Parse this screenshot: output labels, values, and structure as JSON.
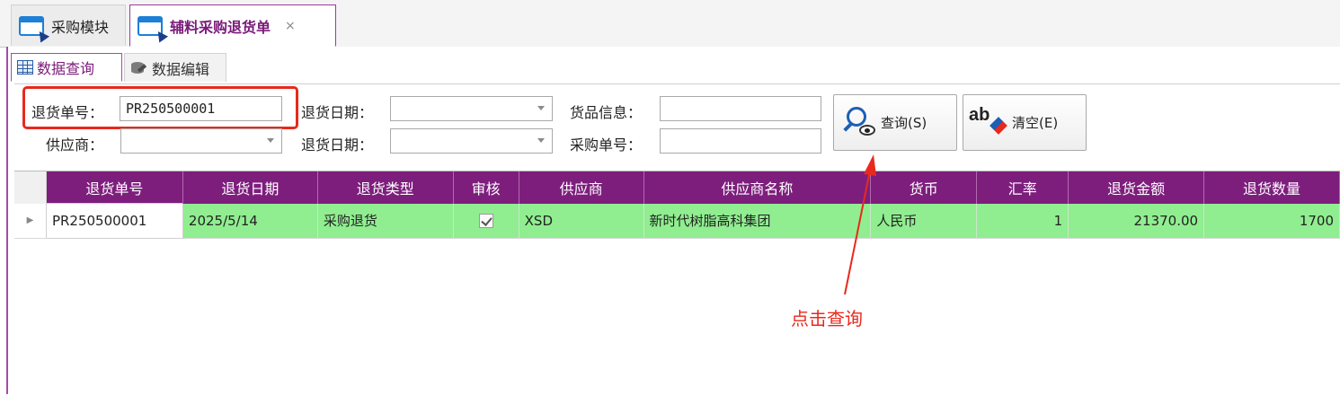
{
  "tabs": [
    {
      "label": "采购模块",
      "active": false
    },
    {
      "label": "辅料采购退货单",
      "active": true,
      "close": "×"
    }
  ],
  "sub_tabs": [
    {
      "label": "数据查询",
      "active": true
    },
    {
      "label": "数据编辑",
      "active": false
    }
  ],
  "query": {
    "return_no_label": "退货单号：",
    "return_no_value": "PR250500001",
    "supplier_label": "供应商：",
    "supplier_value": "",
    "return_date_label_1": "退货日期：",
    "return_date_label_2": "退货日期：",
    "goods_info_label": "货品信息：",
    "purchase_no_label": "采购单号：",
    "search_button": "查询(S)",
    "clear_button": "清空(E)"
  },
  "grid": {
    "columns": [
      "退货单号",
      "退货日期",
      "退货类型",
      "审核",
      "供应商",
      "供应商名称",
      "货币",
      "汇率",
      "退货金额",
      "退货数量"
    ],
    "rows": [
      {
        "return_no": "PR250500001",
        "date": "2025/5/14",
        "type": "采购退货",
        "audited": true,
        "supplier": "XSD",
        "supplier_name": "新时代树脂高科集团",
        "currency": "人民币",
        "rate": "1",
        "amount": "21370.00",
        "qty": "1700"
      }
    ]
  },
  "annotation": {
    "text": "点击查询",
    "color": "#e8291c"
  },
  "colors": {
    "accent": "#7d1e7d",
    "row_bg": "#90ee90",
    "highlight": "#e8291c"
  }
}
